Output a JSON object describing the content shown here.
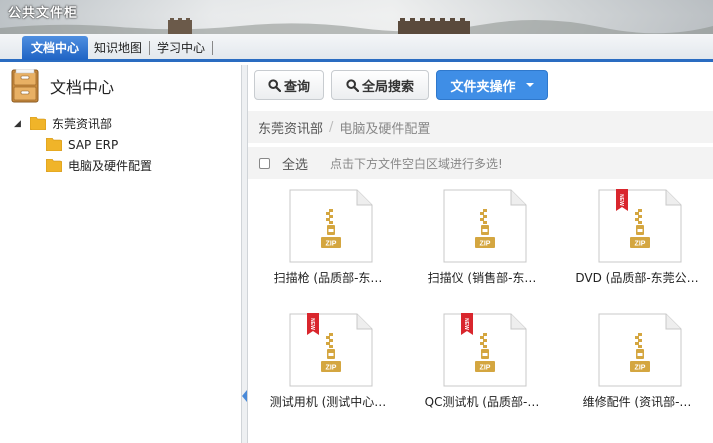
{
  "banner": {
    "title": "公共文件柜"
  },
  "nav": {
    "tabs": [
      {
        "label": "文档中心",
        "active": true
      },
      {
        "label": "知识地图",
        "active": false
      },
      {
        "label": "学习中心",
        "active": false
      }
    ]
  },
  "left": {
    "title": "文档中心",
    "tree": {
      "root": {
        "label": "东莞资讯部",
        "toggle": "◢"
      },
      "children": [
        {
          "label": "SAP ERP"
        },
        {
          "label": "电脑及硬件配置"
        }
      ]
    }
  },
  "toolbar": {
    "query_label": "查询",
    "global_search_label": "全局搜索",
    "folder_ops_label": "文件夹操作"
  },
  "breadcrumb": {
    "items": [
      "东莞资讯部",
      "电脑及硬件配置"
    ],
    "separator": "/"
  },
  "selectbar": {
    "select_all_label": "全选",
    "hint": "点击下方文件空白区域进行多选!"
  },
  "colors": {
    "accent": "#2a6cc1",
    "primary_button": "#3f8ee6",
    "zip_gold": "#d4a640",
    "new_badge": "#d9262d"
  },
  "files": [
    {
      "name": "扫描枪 (品质部-东…",
      "icon": "zip-file-icon",
      "new": false
    },
    {
      "name": "扫描仪 (销售部-东…",
      "icon": "zip-file-icon",
      "new": false
    },
    {
      "name": "DVD (品质部-东莞公…",
      "icon": "zip-file-icon",
      "new": true
    },
    {
      "name": "测试用机 (测试中心…",
      "icon": "zip-file-icon",
      "new": true
    },
    {
      "name": "QC测试机 (品质部-…",
      "icon": "zip-file-icon",
      "new": true
    },
    {
      "name": "维修配件 (资讯部-…",
      "icon": "zip-file-icon",
      "new": false
    }
  ],
  "zip_label": "ZIP",
  "new_badge_text": "NEW"
}
